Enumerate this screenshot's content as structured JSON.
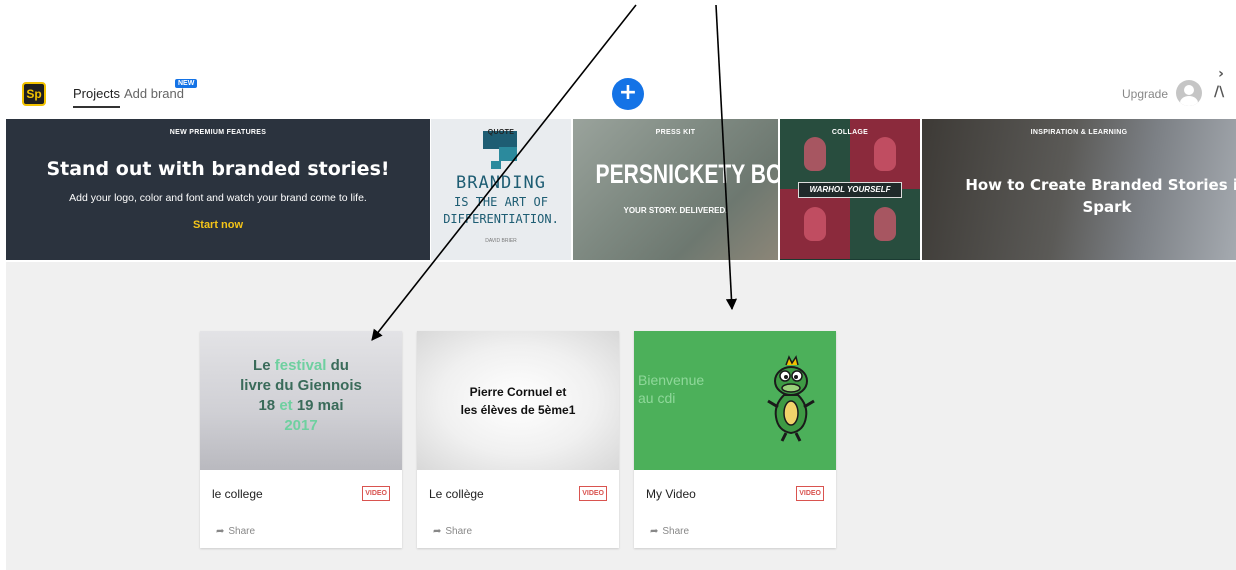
{
  "header": {
    "logo": "Sp",
    "nav_projects": "Projects",
    "nav_add_brand": "Add brand",
    "badge_new": "NEW",
    "create_symbol": "+",
    "upgrade": "Upgrade"
  },
  "banner": {
    "premium": {
      "label": "NEW PREMIUM FEATURES",
      "title": "Stand out with branded stories!",
      "subtitle": "Add your logo, color and font and watch your brand come to life.",
      "cta": "Start now"
    },
    "quote": {
      "label": "QUOTE",
      "line1": "BRANDING",
      "line2": "IS THE ART OF",
      "line3": "DIFFERENTIATION.",
      "author": "DAVID BRIER"
    },
    "press_kit": {
      "label": "PRESS KIT",
      "title": "PERSNICKETY BOX",
      "subtitle": "YOUR STORY. DELIVERED."
    },
    "collage": {
      "label": "COLLAGE",
      "tag": "WARHOL YOURSELF"
    },
    "inspiration": {
      "label": "INSPIRATION & LEARNING",
      "title_line1": "How to Create Branded Stories in",
      "title_line2": "Spark"
    }
  },
  "projects": [
    {
      "title": "le college",
      "type": "VIDEO",
      "share": "Share",
      "thumb_pre": "Le ",
      "thumb_hl": "festival",
      "thumb_post": " du",
      "thumb_line2": "livre du Giennois",
      "thumb_line3a": "18 ",
      "thumb_line3b": "et",
      "thumb_line3c": " 19 mai",
      "thumb_line4": "2017"
    },
    {
      "title": "Le collège",
      "type": "VIDEO",
      "share": "Share",
      "thumb_line1": "Pierre Cornuel et",
      "thumb_line2": "les élèves de 5ème1"
    },
    {
      "title": "My Video",
      "type": "VIDEO",
      "share": "Share",
      "thumb_line1": "Bienvenue",
      "thumb_line2": "au cdi"
    }
  ],
  "colors": {
    "accent_blue": "#1473e6",
    "brand_yellow": "#f2c200",
    "video_badge_red": "#d9534f"
  }
}
